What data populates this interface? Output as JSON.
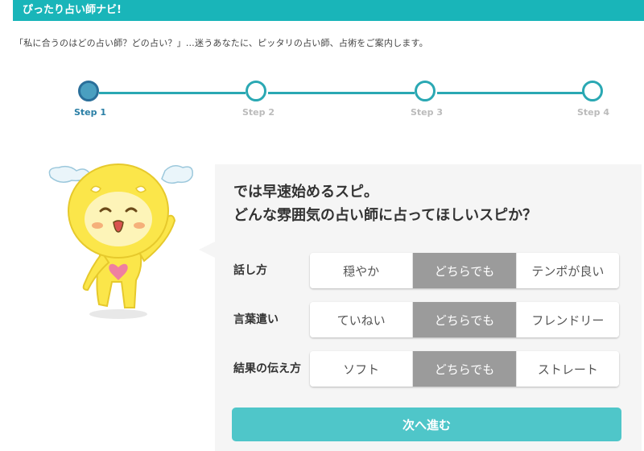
{
  "header": {
    "title": "ぴったり占い師ナビ!"
  },
  "intro": {
    "text": "「私に合うのはどの占い師？どの占い？」…迷うあなたに、ピッタリの占い師、占術をご案内します。"
  },
  "steps": [
    {
      "label": "Step 1",
      "active": true
    },
    {
      "label": "Step 2",
      "active": false
    },
    {
      "label": "Step 3",
      "active": false
    },
    {
      "label": "Step 4",
      "active": false
    }
  ],
  "question": {
    "line1": "では早速始めるスピ。",
    "line2": "どんな雰囲気の占い師に占ってほしいスピか？"
  },
  "rows": [
    {
      "label": "話し方",
      "options": [
        "穏やか",
        "どちらでも",
        "テンポが良い"
      ],
      "selected": "どちらでも"
    },
    {
      "label": "言葉遣い",
      "options": [
        "ていねい",
        "どちらでも",
        "フレンドリー"
      ],
      "selected": "どちらでも"
    },
    {
      "label": "結果の伝え方",
      "options": [
        "ソフト",
        "どちらでも",
        "ストレート"
      ],
      "selected": "どちらでも"
    }
  ],
  "next_button": {
    "label": "次へ進む"
  },
  "colors": {
    "accent": "#19b5b9",
    "step_line": "#2aa8b3",
    "selected_option": "#9b9b9b",
    "next_button": "#4fc6c9"
  },
  "icons": {
    "mascot": "winged-yellow-mascot"
  }
}
